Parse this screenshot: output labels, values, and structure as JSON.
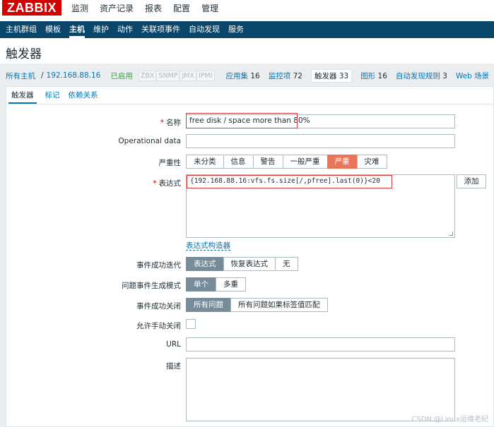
{
  "header": {
    "logo": "ZABBIX",
    "menu": [
      {
        "label": "监测"
      },
      {
        "label": "资产记录"
      },
      {
        "label": "报表"
      },
      {
        "label": "配置"
      },
      {
        "label": "管理"
      }
    ]
  },
  "subnav": {
    "items": [
      {
        "label": "主机群组"
      },
      {
        "label": "模板"
      },
      {
        "label": "主机"
      },
      {
        "label": "维护"
      },
      {
        "label": "动作"
      },
      {
        "label": "关联项事件"
      },
      {
        "label": "自动发现"
      },
      {
        "label": "服务"
      }
    ]
  },
  "page": {
    "title": "触发器"
  },
  "breadcrumb": {
    "all_hosts": "所有主机",
    "host": "192.168.88.16",
    "status": "已启用",
    "interfaces": [
      "ZBX",
      "SNMP",
      "JMX",
      "IPMI"
    ],
    "tabs": [
      {
        "label": "应用集",
        "count": "16"
      },
      {
        "label": "监控项",
        "count": "72"
      },
      {
        "label": "触发器",
        "count": "33"
      },
      {
        "label": "图形",
        "count": "16"
      },
      {
        "label": "自动发现规则",
        "count": "3"
      },
      {
        "label": "Web 场景",
        "count": ""
      }
    ]
  },
  "form": {
    "tabs": [
      {
        "label": "触发器"
      },
      {
        "label": "标记"
      },
      {
        "label": "依赖关系"
      }
    ],
    "name_label": "名称",
    "name_value": "free disk /  space more than 80%",
    "opdata_label": "Operational data",
    "opdata_value": "",
    "severity_label": "严重性",
    "severity_options": [
      "未分类",
      "信息",
      "警告",
      "一般严重",
      "严重",
      "灾难"
    ],
    "expression_label": "表达式",
    "expression_value": "{192.168.88.16:vfs.fs.size[/,pfree].last(0)}<20",
    "add_button": "添加",
    "expression_builder": "表达式构造器",
    "ok_event_label": "事件成功迭代",
    "ok_event_options": [
      "表达式",
      "恢复表达式",
      "无"
    ],
    "problem_mode_label": "问题事件生成模式",
    "problem_mode_options": [
      "单个",
      "多重"
    ],
    "ok_close_label": "事件成功关闭",
    "ok_close_options": [
      "所有问题",
      "所有问题如果标签值匹配"
    ],
    "manual_close_label": "允许手动关闭",
    "url_label": "URL",
    "url_value": "",
    "desc_label": "描述",
    "desc_value": ""
  },
  "watermark": "CSDN @Linux运维老纪",
  "colors": {
    "brand": "#d40000",
    "nav": "#0a466a",
    "link": "#0275b8",
    "severity_high": "#e97659",
    "segment_active": "#768d99",
    "highlight_box": "#e0363a"
  }
}
